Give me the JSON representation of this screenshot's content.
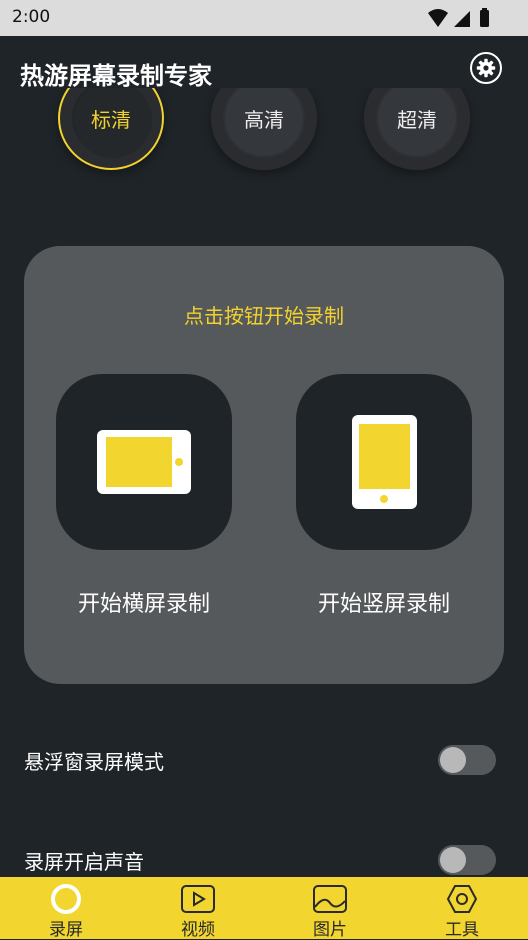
{
  "status": {
    "time": "2:00"
  },
  "header": {
    "title": "热游屏幕录制专家"
  },
  "quality": {
    "options": [
      "标清",
      "高清",
      "超清"
    ],
    "selected": "标清"
  },
  "panel": {
    "prompt": "点击按钮开始录制",
    "landscape_label": "开始横屏录制",
    "portrait_label": "开始竖屏录制"
  },
  "options": [
    {
      "label": "悬浮窗录屏模式",
      "enabled": false
    },
    {
      "label": "录屏开启声音",
      "enabled": false
    }
  ],
  "nav": {
    "items": [
      {
        "label": "录屏",
        "icon": "record-icon",
        "active": true
      },
      {
        "label": "视频",
        "icon": "video-icon",
        "active": false
      },
      {
        "label": "图片",
        "icon": "image-icon",
        "active": false
      },
      {
        "label": "工具",
        "icon": "tools-icon",
        "active": false
      }
    ]
  },
  "colors": {
    "accent": "#f2d62f",
    "background": "#1f2428",
    "panel": "#56595b"
  }
}
